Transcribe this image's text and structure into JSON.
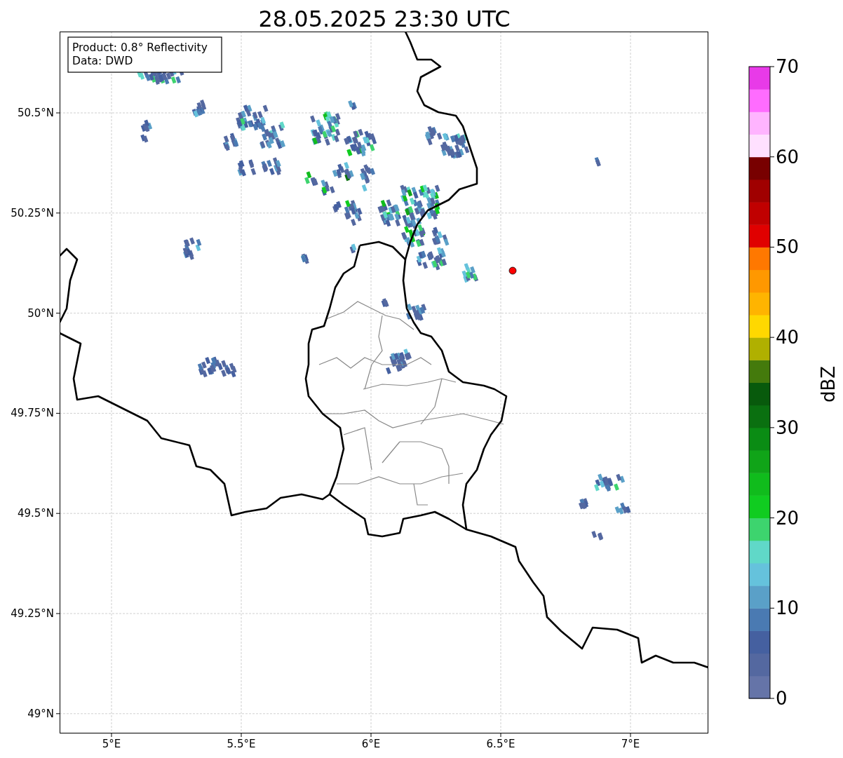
{
  "title": "28.05.2025 23:30 UTC",
  "legend": {
    "lines": [
      "Product: 0.8° Reflectivity",
      "Data: DWD"
    ]
  },
  "axes": {
    "x_ticks": [
      "5°E",
      "5.5°E",
      "6°E",
      "6.5°E",
      "7°E"
    ],
    "y_ticks": [
      "50.5°N",
      "50.25°N",
      "50°N",
      "49.75°N",
      "49.5°N",
      "49.25°N",
      "49°N"
    ]
  },
  "colorbar": {
    "label": "dBZ",
    "ticks": [
      "70",
      "60",
      "50",
      "40",
      "30",
      "20",
      "10",
      "0"
    ],
    "segments": [
      {
        "color": "#6574a8"
      },
      {
        "color": "#5468a0"
      },
      {
        "color": "#4560a0"
      },
      {
        "color": "#4a7ab2"
      },
      {
        "color": "#5aa0c8"
      },
      {
        "color": "#65c2dc"
      },
      {
        "color": "#60d8c8"
      },
      {
        "color": "#3dd46e"
      },
      {
        "color": "#10cc20"
      },
      {
        "color": "#10bc1c"
      },
      {
        "color": "#10a418"
      },
      {
        "color": "#0a8c14"
      },
      {
        "color": "#0a7010"
      },
      {
        "color": "#085a0c"
      },
      {
        "color": "#447a0c"
      },
      {
        "color": "#b0b000"
      },
      {
        "color": "#ffd800"
      },
      {
        "color": "#ffb400"
      },
      {
        "color": "#ff9800"
      },
      {
        "color": "#ff7800"
      },
      {
        "color": "#e00000"
      },
      {
        "color": "#c00000"
      },
      {
        "color": "#a00000"
      },
      {
        "color": "#780000"
      },
      {
        "color": "#ffe0ff"
      },
      {
        "color": "#ffb4ff"
      },
      {
        "color": "#ff6cff"
      },
      {
        "color": "#e83ae8"
      }
    ]
  }
}
